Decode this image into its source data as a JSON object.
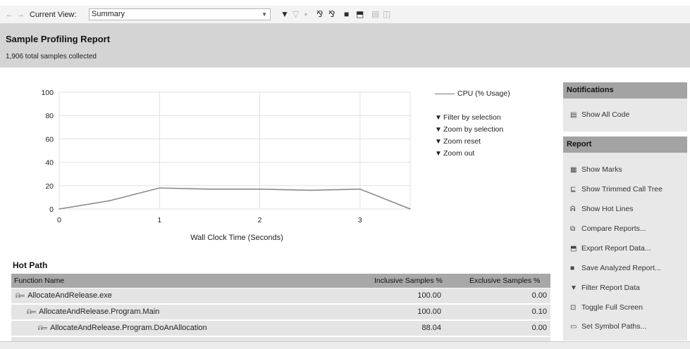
{
  "toolbar": {
    "back_glyph": "←",
    "forward_glyph": "→",
    "current_view_label": "Current View:",
    "current_view_value": "Summary"
  },
  "header": {
    "title": "Sample Profiling Report",
    "subtitle": "1,906 total samples collected"
  },
  "chart": {
    "legend_cpu": "CPU (% Usage)",
    "actions": [
      "Filter by selection",
      "Zoom by selection",
      "Zoom reset",
      "Zoom out"
    ]
  },
  "chart_data": {
    "type": "line",
    "xlabel": "Wall Clock Time (Seconds)",
    "ylabel": "",
    "xlim": [
      0,
      3.5
    ],
    "ylim": [
      0,
      100
    ],
    "x_ticks": [
      0,
      1,
      2,
      3
    ],
    "y_ticks": [
      0,
      20,
      40,
      60,
      80,
      100
    ],
    "series": [
      {
        "name": "CPU (% Usage)",
        "color": "#8a8a8a",
        "x": [
          0,
          0.5,
          1.0,
          1.5,
          2.0,
          2.5,
          3.0,
          3.5
        ],
        "y": [
          0,
          7,
          18,
          17,
          17,
          16,
          17,
          0
        ]
      }
    ]
  },
  "hot_path": {
    "title": "Hot Path",
    "columns": [
      "Function Name",
      "Inclusive Samples %",
      "Exclusive Samples %"
    ],
    "rows": [
      {
        "name": "AllocateAndRelease.exe",
        "inclusive": "100.00",
        "exclusive": "0.00"
      },
      {
        "name": "AllocateAndRelease.Program.Main",
        "inclusive": "100.00",
        "exclusive": "0.10"
      },
      {
        "name": "AllocateAndRelease.Program.DoAnAllocation",
        "inclusive": "88.04",
        "exclusive": "0.00"
      }
    ]
  },
  "notifications": {
    "title": "Notifications",
    "items": [
      "Show All Code"
    ]
  },
  "report": {
    "title": "Report",
    "items": [
      "Show Marks",
      "Show Trimmed Call Tree",
      "Show Hot Lines",
      "Compare Reports...",
      "Export Report Data...",
      "Save Analyzed Report...",
      "Filter Report Data",
      "Toggle Full Screen",
      "Set Symbol Paths..."
    ]
  }
}
